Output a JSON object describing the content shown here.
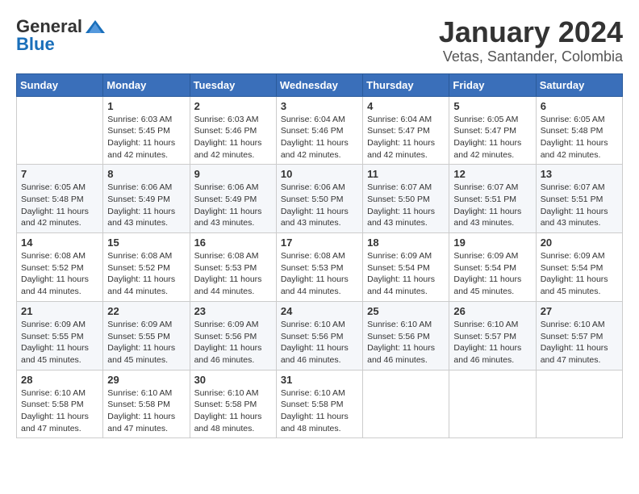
{
  "logo": {
    "general": "General",
    "blue": "Blue"
  },
  "title": "January 2024",
  "subtitle": "Vetas, Santander, Colombia",
  "days_header": [
    "Sunday",
    "Monday",
    "Tuesday",
    "Wednesday",
    "Thursday",
    "Friday",
    "Saturday"
  ],
  "weeks": [
    [
      {
        "day": "",
        "sunrise": "",
        "sunset": "",
        "daylight": ""
      },
      {
        "day": "1",
        "sunrise": "Sunrise: 6:03 AM",
        "sunset": "Sunset: 5:45 PM",
        "daylight": "Daylight: 11 hours and 42 minutes."
      },
      {
        "day": "2",
        "sunrise": "Sunrise: 6:03 AM",
        "sunset": "Sunset: 5:46 PM",
        "daylight": "Daylight: 11 hours and 42 minutes."
      },
      {
        "day": "3",
        "sunrise": "Sunrise: 6:04 AM",
        "sunset": "Sunset: 5:46 PM",
        "daylight": "Daylight: 11 hours and 42 minutes."
      },
      {
        "day": "4",
        "sunrise": "Sunrise: 6:04 AM",
        "sunset": "Sunset: 5:47 PM",
        "daylight": "Daylight: 11 hours and 42 minutes."
      },
      {
        "day": "5",
        "sunrise": "Sunrise: 6:05 AM",
        "sunset": "Sunset: 5:47 PM",
        "daylight": "Daylight: 11 hours and 42 minutes."
      },
      {
        "day": "6",
        "sunrise": "Sunrise: 6:05 AM",
        "sunset": "Sunset: 5:48 PM",
        "daylight": "Daylight: 11 hours and 42 minutes."
      }
    ],
    [
      {
        "day": "7",
        "sunrise": "Sunrise: 6:05 AM",
        "sunset": "Sunset: 5:48 PM",
        "daylight": "Daylight: 11 hours and 42 minutes."
      },
      {
        "day": "8",
        "sunrise": "Sunrise: 6:06 AM",
        "sunset": "Sunset: 5:49 PM",
        "daylight": "Daylight: 11 hours and 43 minutes."
      },
      {
        "day": "9",
        "sunrise": "Sunrise: 6:06 AM",
        "sunset": "Sunset: 5:49 PM",
        "daylight": "Daylight: 11 hours and 43 minutes."
      },
      {
        "day": "10",
        "sunrise": "Sunrise: 6:06 AM",
        "sunset": "Sunset: 5:50 PM",
        "daylight": "Daylight: 11 hours and 43 minutes."
      },
      {
        "day": "11",
        "sunrise": "Sunrise: 6:07 AM",
        "sunset": "Sunset: 5:50 PM",
        "daylight": "Daylight: 11 hours and 43 minutes."
      },
      {
        "day": "12",
        "sunrise": "Sunrise: 6:07 AM",
        "sunset": "Sunset: 5:51 PM",
        "daylight": "Daylight: 11 hours and 43 minutes."
      },
      {
        "day": "13",
        "sunrise": "Sunrise: 6:07 AM",
        "sunset": "Sunset: 5:51 PM",
        "daylight": "Daylight: 11 hours and 43 minutes."
      }
    ],
    [
      {
        "day": "14",
        "sunrise": "Sunrise: 6:08 AM",
        "sunset": "Sunset: 5:52 PM",
        "daylight": "Daylight: 11 hours and 44 minutes."
      },
      {
        "day": "15",
        "sunrise": "Sunrise: 6:08 AM",
        "sunset": "Sunset: 5:52 PM",
        "daylight": "Daylight: 11 hours and 44 minutes."
      },
      {
        "day": "16",
        "sunrise": "Sunrise: 6:08 AM",
        "sunset": "Sunset: 5:53 PM",
        "daylight": "Daylight: 11 hours and 44 minutes."
      },
      {
        "day": "17",
        "sunrise": "Sunrise: 6:08 AM",
        "sunset": "Sunset: 5:53 PM",
        "daylight": "Daylight: 11 hours and 44 minutes."
      },
      {
        "day": "18",
        "sunrise": "Sunrise: 6:09 AM",
        "sunset": "Sunset: 5:54 PM",
        "daylight": "Daylight: 11 hours and 44 minutes."
      },
      {
        "day": "19",
        "sunrise": "Sunrise: 6:09 AM",
        "sunset": "Sunset: 5:54 PM",
        "daylight": "Daylight: 11 hours and 45 minutes."
      },
      {
        "day": "20",
        "sunrise": "Sunrise: 6:09 AM",
        "sunset": "Sunset: 5:54 PM",
        "daylight": "Daylight: 11 hours and 45 minutes."
      }
    ],
    [
      {
        "day": "21",
        "sunrise": "Sunrise: 6:09 AM",
        "sunset": "Sunset: 5:55 PM",
        "daylight": "Daylight: 11 hours and 45 minutes."
      },
      {
        "day": "22",
        "sunrise": "Sunrise: 6:09 AM",
        "sunset": "Sunset: 5:55 PM",
        "daylight": "Daylight: 11 hours and 45 minutes."
      },
      {
        "day": "23",
        "sunrise": "Sunrise: 6:09 AM",
        "sunset": "Sunset: 5:56 PM",
        "daylight": "Daylight: 11 hours and 46 minutes."
      },
      {
        "day": "24",
        "sunrise": "Sunrise: 6:10 AM",
        "sunset": "Sunset: 5:56 PM",
        "daylight": "Daylight: 11 hours and 46 minutes."
      },
      {
        "day": "25",
        "sunrise": "Sunrise: 6:10 AM",
        "sunset": "Sunset: 5:56 PM",
        "daylight": "Daylight: 11 hours and 46 minutes."
      },
      {
        "day": "26",
        "sunrise": "Sunrise: 6:10 AM",
        "sunset": "Sunset: 5:57 PM",
        "daylight": "Daylight: 11 hours and 46 minutes."
      },
      {
        "day": "27",
        "sunrise": "Sunrise: 6:10 AM",
        "sunset": "Sunset: 5:57 PM",
        "daylight": "Daylight: 11 hours and 47 minutes."
      }
    ],
    [
      {
        "day": "28",
        "sunrise": "Sunrise: 6:10 AM",
        "sunset": "Sunset: 5:58 PM",
        "daylight": "Daylight: 11 hours and 47 minutes."
      },
      {
        "day": "29",
        "sunrise": "Sunrise: 6:10 AM",
        "sunset": "Sunset: 5:58 PM",
        "daylight": "Daylight: 11 hours and 47 minutes."
      },
      {
        "day": "30",
        "sunrise": "Sunrise: 6:10 AM",
        "sunset": "Sunset: 5:58 PM",
        "daylight": "Daylight: 11 hours and 48 minutes."
      },
      {
        "day": "31",
        "sunrise": "Sunrise: 6:10 AM",
        "sunset": "Sunset: 5:58 PM",
        "daylight": "Daylight: 11 hours and 48 minutes."
      },
      {
        "day": "",
        "sunrise": "",
        "sunset": "",
        "daylight": ""
      },
      {
        "day": "",
        "sunrise": "",
        "sunset": "",
        "daylight": ""
      },
      {
        "day": "",
        "sunrise": "",
        "sunset": "",
        "daylight": ""
      }
    ]
  ]
}
